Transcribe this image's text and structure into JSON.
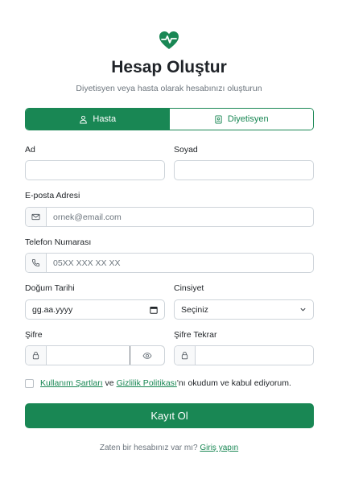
{
  "colors": {
    "accent": "#198754",
    "muted": "#6c757d",
    "border": "#ced4da"
  },
  "header": {
    "logo_icon": "heart-pulse-icon",
    "title": "Hesap Oluştur",
    "subtitle": "Diyetisyen veya hasta olarak hesabınızı oluşturun"
  },
  "role_toggle": {
    "patient": {
      "label": "Hasta",
      "icon": "user-icon",
      "active": true
    },
    "dietitian": {
      "label": "Diyetisyen",
      "icon": "id-badge-icon",
      "active": false
    }
  },
  "form": {
    "first_name": {
      "label": "Ad",
      "value": ""
    },
    "last_name": {
      "label": "Soyad",
      "value": ""
    },
    "email": {
      "label": "E-posta Adresi",
      "placeholder": "ornek@email.com",
      "icon": "envelope-icon"
    },
    "phone": {
      "label": "Telefon Numarası",
      "placeholder": "05XX XXX XX XX",
      "icon": "phone-icon"
    },
    "birth_date": {
      "label": "Doğum Tarihi",
      "placeholder": "gg.aa.yyyy",
      "icon": "calendar-icon"
    },
    "gender": {
      "label": "Cinsiyet",
      "selected": "Seçiniz",
      "icon": "chevron-down-icon"
    },
    "password": {
      "label": "Şifre",
      "icon": "lock-icon",
      "toggle_icon": "eye-icon"
    },
    "password_confirm": {
      "label": "Şifre Tekrar",
      "icon": "lock-icon"
    }
  },
  "terms": {
    "terms_link": "Kullanım Şartları",
    "and_text": " ve ",
    "privacy_link": "Gizlilik Politikası",
    "suffix": "'nı okudum ve kabul ediyorum."
  },
  "submit_label": "Kayıt Ol",
  "footer": {
    "prompt": "Zaten bir hesabınız var mı?",
    "login_link": "Giriş yapın"
  }
}
